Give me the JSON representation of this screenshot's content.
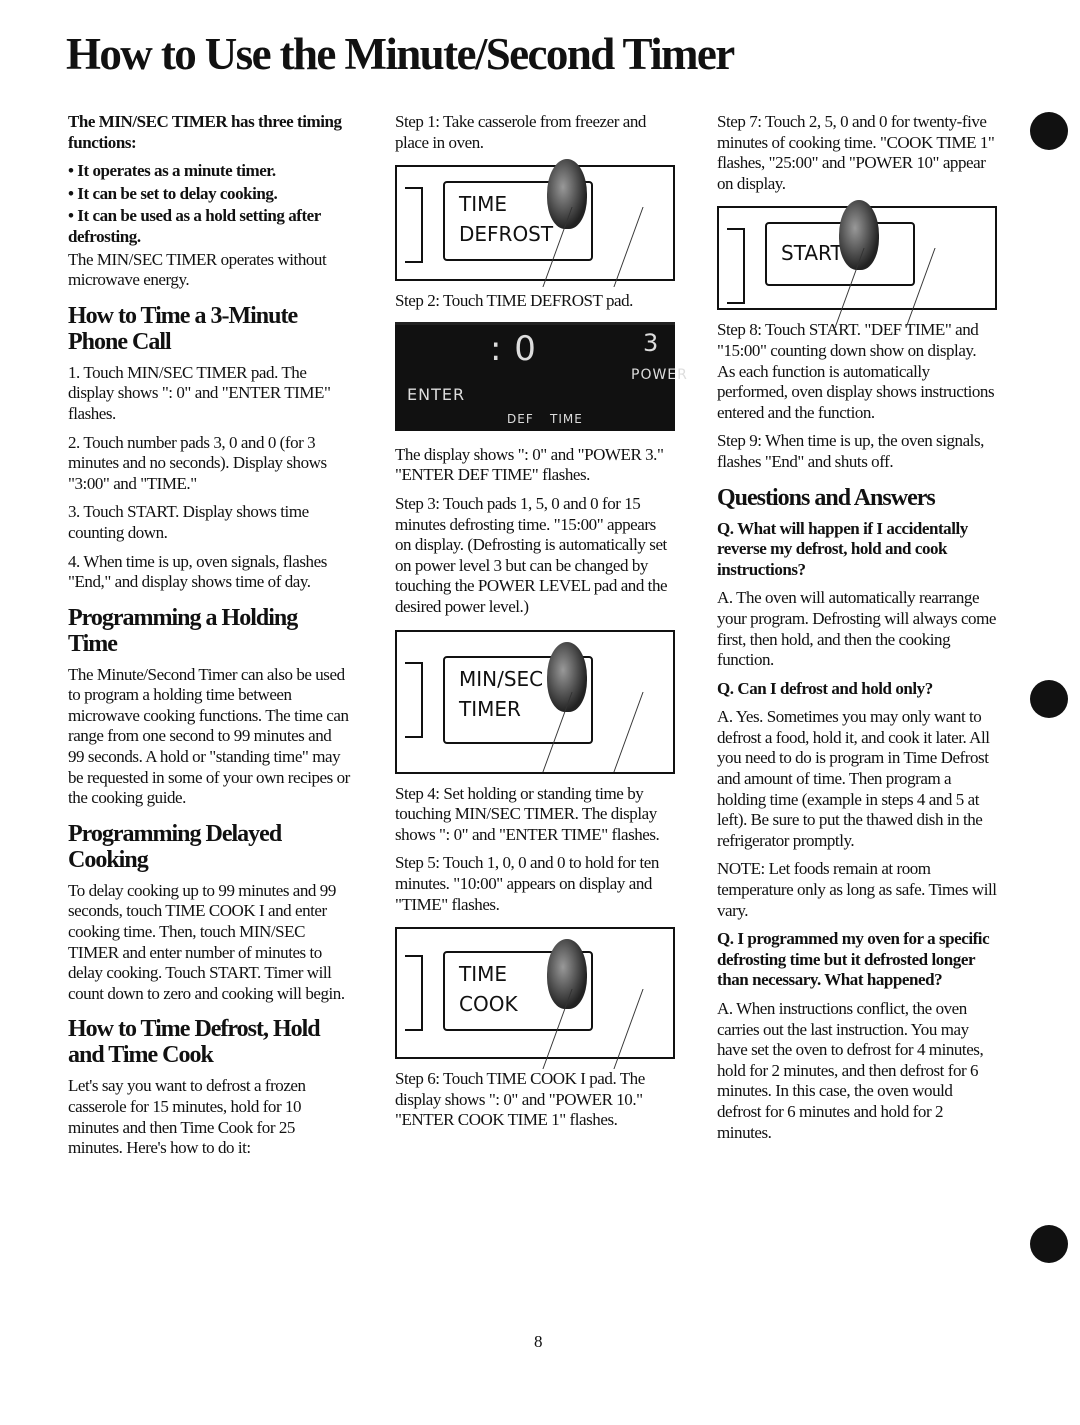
{
  "title": "How to Use the Minute/Second Timer",
  "col1": {
    "intro": "The MIN/SEC TIMER has three timing functions:",
    "bullets": [
      "• It operates as a minute timer.",
      "• It can be set to delay cooking.",
      "• It can be used as a hold setting after defrosting."
    ],
    "note": "The MIN/SEC TIMER operates without microwave energy.",
    "h_phone": "How to Time a 3-Minute Phone Call",
    "phone_steps": [
      "1. Touch MIN/SEC TIMER pad. The display shows \": 0\" and \"ENTER TIME\" flashes.",
      "2. Touch number pads 3, 0 and 0 (for 3 minutes and no seconds). Display shows \"3:00\" and \"TIME.\"",
      "3. Touch START. Display shows time counting down.",
      "4. When time is up, oven signals, flashes \"End,\" and display shows time of day."
    ],
    "h_holding": "Programming a Holding Time",
    "holding_text": "The Minute/Second Timer can also be used to program a holding time between microwave cooking functions. The time can range from one second to 99 minutes and 99 seconds. A hold or \"standing time\" may be requested in some of your own recipes or the cooking guide.",
    "h_delayed": "Programming Delayed Cooking",
    "delayed_text": "To delay cooking up to 99 minutes and 99 seconds, touch TIME COOK I and enter cooking time. Then, touch MIN/SEC TIMER and enter number of minutes to delay cooking. Touch START. Timer will count down to zero and cooking will begin.",
    "h_defrost": "How to Time Defrost, Hold and Time Cook",
    "defrost_text": "Let's say you want to defrost a frozen casserole for 15 minutes, hold for 10 minutes and then Time Cook for 25 minutes. Here's how to do it:"
  },
  "col2": {
    "step1": "Step 1: Take casserole from freezer and place in oven.",
    "pad1": [
      "TIME",
      "DEFROST"
    ],
    "step2": "Step 2: Touch TIME DEFROST pad.",
    "display": {
      "colon_zero": ": 0",
      "power_digit": "3",
      "power": "POWER",
      "enter": "ENTER",
      "def": "DEF",
      "time": "TIME"
    },
    "step2_text": "The display shows \": 0\" and \"POWER 3.\" \"ENTER DEF TIME\" flashes.",
    "step3": "Step 3: Touch pads 1, 5, 0 and 0 for 15 minutes defrosting time. \"15:00\" appears on display. (Defrosting is automatically set on power level 3 but can be changed by touching the POWER LEVEL pad and the desired power level.)",
    "pad2": [
      "MIN/SEC",
      "TIMER"
    ],
    "step4": "Step 4: Set holding or standing time by touching MIN/SEC TIMER. The display shows \": 0\" and \"ENTER TIME\" flashes.",
    "step5": "Step 5: Touch 1, 0, 0 and 0 to hold for ten minutes. \"10:00\" appears on display and \"TIME\" flashes.",
    "pad3": [
      "TIME",
      "COOK"
    ],
    "step6": "Step 6: Touch TIME COOK I pad. The display shows \": 0\" and \"POWER 10.\" \"ENTER COOK TIME 1\" flashes."
  },
  "col3": {
    "step7": "Step 7: Touch 2, 5, 0 and 0 for twenty-five minutes of cooking time. \"COOK TIME 1\" flashes, \"25:00\" and \"POWER 10\" appear on display.",
    "pad4": [
      "START"
    ],
    "step8": "Step 8: Touch START. \"DEF TIME\" and \"15:00\" counting down show on display. As each function is automatically performed, oven display shows instructions entered and the function.",
    "step9": "Step 9: When time is up, the oven signals, flashes \"End\" and shuts off.",
    "h_qa": "Questions and Answers",
    "q1": "Q. What will happen if I accidentally reverse my defrost, hold and cook instructions?",
    "a1": "A. The oven will automatically rearrange your program. Defrosting will always come first, then hold, and then the cooking function.",
    "q2": "Q. Can I defrost and hold only?",
    "a2": "A. Yes. Sometimes you may only want to defrost a food, hold it, and cook it later. All you need to do is program in Time Defrost and amount of time. Then program a holding time (example in steps 4 and 5 at left). Be sure to put the thawed dish in the refrigerator promptly.",
    "note": "NOTE: Let foods remain at room temperature only as long as safe. Times will vary.",
    "q3": "Q. I programmed my oven for a specific defrosting time but it defrosted longer than necessary. What happened?",
    "a3": "A. When instructions conflict, the oven carries out the last instruction. You may have set the oven to defrost for 4 minutes, hold for 2 minutes, and then defrost for 6 minutes. In this case, the oven would defrost for 6 minutes and hold for 2 minutes."
  },
  "page_number": "8"
}
